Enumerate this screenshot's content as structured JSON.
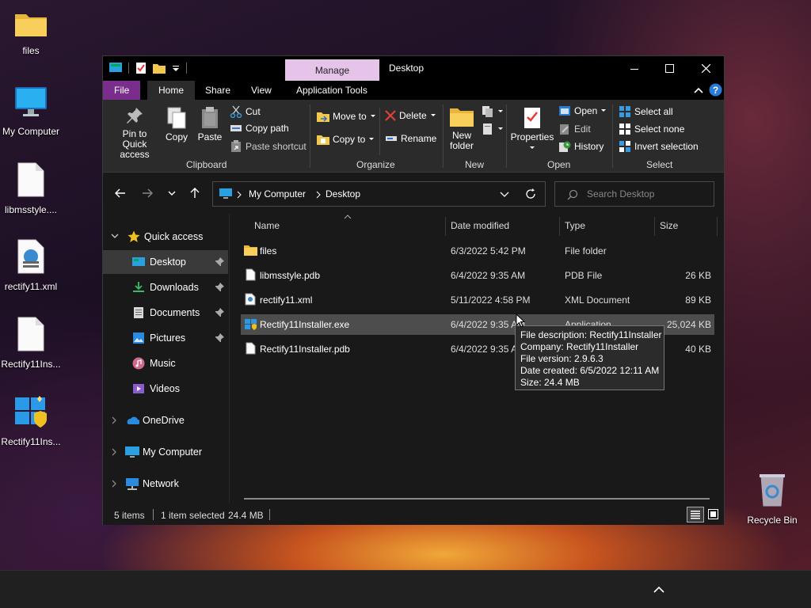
{
  "desktop": {
    "icons": [
      {
        "label": "files",
        "icon": "folder-icon"
      },
      {
        "label": "My Computer",
        "icon": "computer-icon"
      },
      {
        "label": "libmsstyle....",
        "icon": "file-icon"
      },
      {
        "label": "rectify11.xml",
        "icon": "xml-file-icon"
      },
      {
        "label": "Rectify11Ins...",
        "icon": "file-icon"
      },
      {
        "label": "Rectify11Ins...",
        "icon": "installer-icon"
      },
      {
        "label": "Recycle Bin",
        "icon": "recycle-bin-icon"
      }
    ]
  },
  "window": {
    "title": "Desktop",
    "contextual_tab": "Manage",
    "tabs": {
      "file": "File",
      "home": "Home",
      "share": "Share",
      "view": "View",
      "app_tools": "Application Tools"
    },
    "ribbon": {
      "clipboard": {
        "label": "Clipboard",
        "pin": "Pin to Quick access",
        "pin_l1": "Pin to Quick",
        "pin_l2": "access",
        "copy": "Copy",
        "paste": "Paste",
        "cut": "Cut",
        "copy_path": "Copy path",
        "paste_shortcut": "Paste shortcut"
      },
      "organize": {
        "label": "Organize",
        "move_to": "Move to",
        "copy_to": "Copy to",
        "delete": "Delete",
        "rename": "Rename"
      },
      "new": {
        "label": "New",
        "new_folder_l1": "New",
        "new_folder_l2": "folder"
      },
      "open": {
        "label": "Open",
        "properties": "Properties",
        "open": "Open",
        "edit": "Edit",
        "history": "History"
      },
      "select": {
        "label": "Select",
        "select_all": "Select all",
        "select_none": "Select none",
        "invert": "Invert selection"
      }
    },
    "address": {
      "crumbs": [
        "My Computer",
        "Desktop"
      ]
    },
    "search": {
      "placeholder": "Search Desktop"
    },
    "nav": {
      "quick_access": "Quick access",
      "items": [
        {
          "label": "Desktop",
          "pinned": true
        },
        {
          "label": "Downloads",
          "pinned": true
        },
        {
          "label": "Documents",
          "pinned": true
        },
        {
          "label": "Pictures",
          "pinned": true
        },
        {
          "label": "Music",
          "pinned": false
        },
        {
          "label": "Videos",
          "pinned": false
        }
      ],
      "onedrive": "OneDrive",
      "my_computer": "My Computer",
      "network": "Network"
    },
    "columns": {
      "name": "Name",
      "date": "Date modified",
      "type": "Type",
      "size": "Size"
    },
    "files": [
      {
        "name": "files",
        "date": "6/3/2022 5:42 PM",
        "type": "File folder",
        "size": ""
      },
      {
        "name": "libmsstyle.pdb",
        "date": "6/4/2022 9:35 AM",
        "type": "PDB File",
        "size": "26 KB"
      },
      {
        "name": "rectify11.xml",
        "date": "5/11/2022 4:58 PM",
        "type": "XML Document",
        "size": "89 KB"
      },
      {
        "name": "Rectify11Installer.exe",
        "date": "6/4/2022 9:35 AM",
        "type": "Application",
        "size": "25,024 KB"
      },
      {
        "name": "Rectify11Installer.pdb",
        "date": "6/4/2022 9:35 AM",
        "type": "",
        "size": "40 KB"
      }
    ],
    "tooltip": {
      "description": "File description: Rectify11Installer",
      "company": "Company: Rectify11Installer",
      "version": "File version: 2.9.6.3",
      "created": "Date created: 6/5/2022 12:11 AM",
      "size": "Size: 24.4 MB"
    },
    "status": {
      "items": "5 items",
      "selected": "1 item selected",
      "size": "24.4 MB"
    }
  },
  "colors": {
    "accent_file_tab": "#7a2e8c",
    "manage_tab": "#e6c4ea",
    "selection": "#4d4d4d"
  }
}
